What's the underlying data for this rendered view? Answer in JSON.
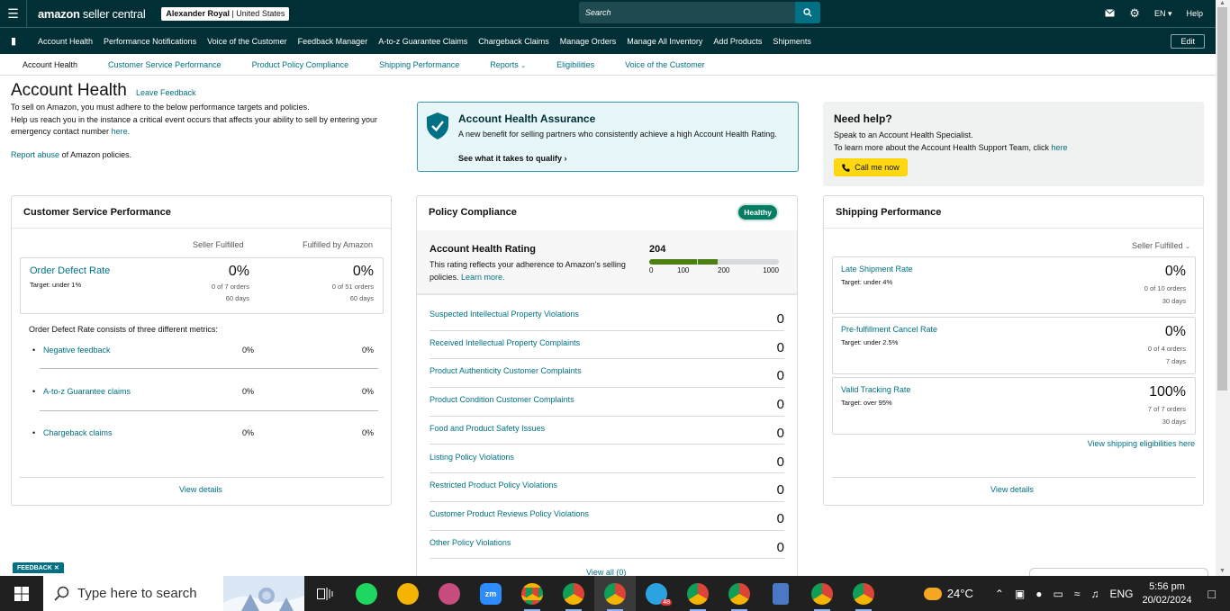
{
  "topbar": {
    "logo_main": "amazon",
    "logo_sub": "seller central",
    "account_name": "Alexander Royal",
    "account_region": "United States",
    "search_placeholder": "Search",
    "lang": "EN",
    "help": "Help"
  },
  "nav": {
    "items": [
      "Account Health",
      "Performance Notifications",
      "Voice of the Customer",
      "Feedback Manager",
      "A-to-z Guarantee Claims",
      "Chargeback Claims",
      "Manage Orders",
      "Manage All Inventory",
      "Add Products",
      "Shipments"
    ],
    "edit": "Edit"
  },
  "subnav": {
    "items": [
      "Account Health",
      "Customer Service Performance",
      "Product Policy Compliance",
      "Shipping Performance",
      "Reports",
      "Eligibilities",
      "Voice of the Customer"
    ]
  },
  "page": {
    "title": "Account Health",
    "leave_feedback": "Leave Feedback",
    "intro_line1": "To sell on Amazon, you must adhere to the below performance targets and policies.",
    "intro_line2": "Help us reach you in the instance a critical event occurs that affects your ability to sell by entering your emergency contact number",
    "intro_here": "here.",
    "report_link": "Report abuse",
    "report_rest": "of Amazon policies."
  },
  "assurance": {
    "title": "Account Health Assurance",
    "text": "A new benefit for selling partners who consistently achieve a high Account Health Rating.",
    "link": "See what it takes to qualify"
  },
  "help": {
    "title": "Need help?",
    "line1": "Speak to an Account Health Specialist.",
    "line2": "To learn more about the Account Health Support Team, click",
    "here": "here",
    "call": "Call me now"
  },
  "csp": {
    "title": "Customer Service Performance",
    "col1": "Seller Fulfilled",
    "col2": "Fulfilled by Amazon",
    "odr_title": "Order Defect Rate",
    "odr_target": "Target: under 1%",
    "sf_pct": "0%",
    "sf_orders": "0 of 7 orders",
    "sf_days": "60 days",
    "fba_pct": "0%",
    "fba_orders": "0 of 51 orders",
    "fba_days": "60 days",
    "note": "Order Defect Rate consists of three different metrics:",
    "metrics": [
      {
        "label": "Negative feedback",
        "sf": "0%",
        "fba": "0%"
      },
      {
        "label": "A-to-z Guarantee claims",
        "sf": "0%",
        "fba": "0%"
      },
      {
        "label": "Chargeback claims",
        "sf": "0%",
        "fba": "0%"
      }
    ],
    "view_details": "View details"
  },
  "policy": {
    "title": "Policy Compliance",
    "badge": "Healthy",
    "ahr_title": "Account Health Rating",
    "ahr_desc": "This rating reflects your adherence to Amazon's selling policies.",
    "learn_more": "Learn more.",
    "score": "204",
    "ticks": [
      "0",
      "100",
      "200",
      "1000"
    ],
    "rows": [
      {
        "label": "Suspected Intellectual Property Violations",
        "value": "0"
      },
      {
        "label": "Received Intellectual Property Complaints",
        "value": "0"
      },
      {
        "label": "Product Authenticity Customer Complaints",
        "value": "0"
      },
      {
        "label": "Product Condition Customer Complaints",
        "value": "0"
      },
      {
        "label": "Food and Product Safety Issues",
        "value": "0"
      },
      {
        "label": "Listing Policy Violations",
        "value": "0"
      },
      {
        "label": "Restricted Product Policy Violations",
        "value": "0"
      },
      {
        "label": "Customer Product Reviews Policy Violations",
        "value": "0"
      },
      {
        "label": "Other Policy Violations",
        "value": "0"
      }
    ],
    "view_all": "View all (0)"
  },
  "shipping": {
    "title": "Shipping Performance",
    "filter": "Seller Fulfilled",
    "boxes": [
      {
        "title": "Late Shipment Rate",
        "target": "Target: under 4%",
        "value": "0%",
        "orders": "0 of 10 orders",
        "days": "30 days"
      },
      {
        "title": "Pre-fulfillment Cancel Rate",
        "target": "Target: under 2.5%",
        "value": "0%",
        "orders": "0 of 4 orders",
        "days": "7 days"
      },
      {
        "title": "Valid Tracking Rate",
        "target": "Target: over 95%",
        "value": "100%",
        "orders": "7 of 7 orders",
        "days": "30 days"
      }
    ],
    "eligibilities": "View shipping eligibilities here",
    "view_details": "View details"
  },
  "feedback_tag": "FEEDBACK",
  "taskbar": {
    "search_placeholder": "Type here to search",
    "temp": "24°C",
    "lang": "ENG",
    "time": "5:56 pm",
    "date": "20/02/2024",
    "telegram_badge": "48",
    "icons": [
      "task-view-icon",
      "spotify-icon",
      "game-icon",
      "app-icon",
      "zoom-icon",
      "chrome-icon",
      "chrome-icon",
      "chrome-icon",
      "telegram-icon",
      "chrome-icon",
      "chrome-icon",
      "calculator-icon",
      "chrome-icon",
      "chrome-icon"
    ]
  },
  "colors": {
    "header_bg": "#002f36",
    "link": "#007185",
    "healthy": "#067d62",
    "button_yellow": "#ffd814"
  }
}
